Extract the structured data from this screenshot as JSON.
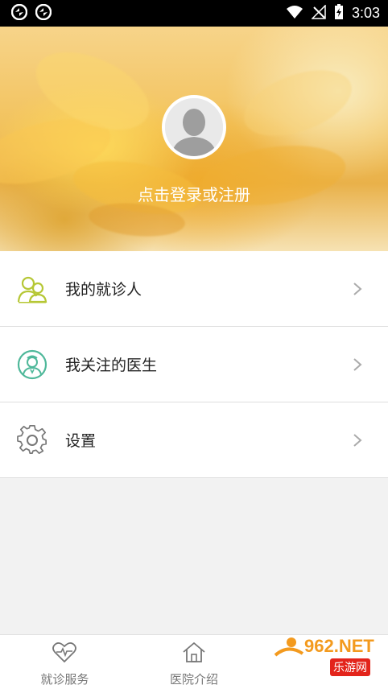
{
  "status_bar": {
    "time": "3:03",
    "icons": [
      "sync-icon",
      "sync-icon",
      "wifi-icon",
      "no-signal-icon",
      "battery-charging-icon"
    ]
  },
  "header": {
    "login_text": "点击登录或注册",
    "avatar_icon": "default-avatar-icon"
  },
  "menu": {
    "items": [
      {
        "label": "我的就诊人",
        "icon": "patients-icon",
        "icon_color": "#b6c735"
      },
      {
        "label": "我关注的医生",
        "icon": "doctor-icon",
        "icon_color": "#4fb89a"
      },
      {
        "label": "设置",
        "icon": "gear-icon",
        "icon_color": "#777777"
      }
    ]
  },
  "bottom_nav": {
    "tabs": [
      {
        "label": "就诊服务",
        "icon": "heart-pulse-icon"
      },
      {
        "label": "医院介绍",
        "icon": "home-icon"
      }
    ]
  },
  "watermark": {
    "brand": "962.NET",
    "sub": "乐游网"
  }
}
